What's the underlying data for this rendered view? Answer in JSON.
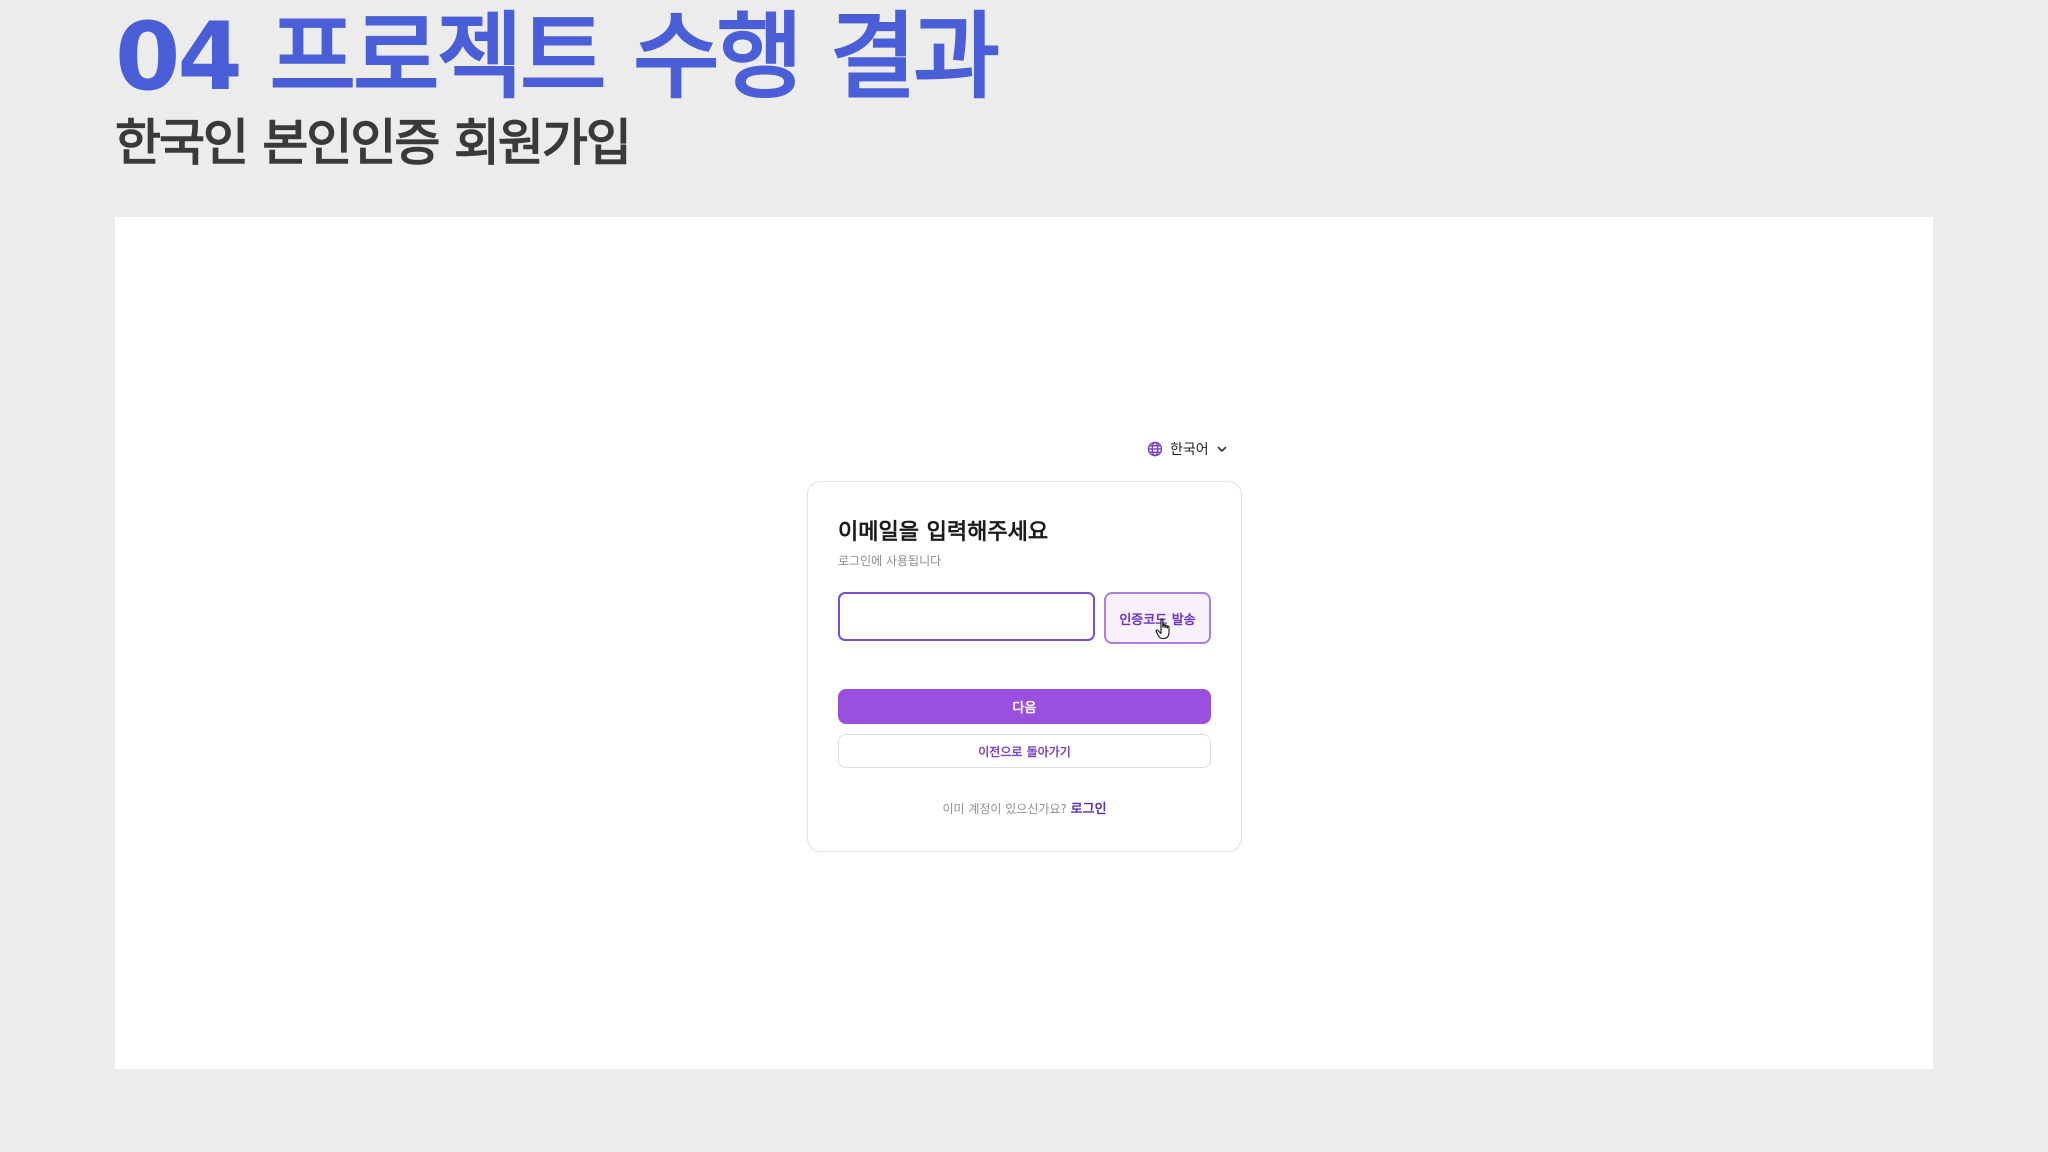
{
  "slide": {
    "title": "04 프로젝트 수행 결과",
    "subtitle": "한국인 본인인증 회원가입"
  },
  "language_selector": {
    "icon": "globe-icon",
    "label": "한국어",
    "caret_icon": "chevron-down-icon"
  },
  "signup_card": {
    "title": "이메일을 입력해주세요",
    "description": "로그인에 사용됩니다",
    "email_input": {
      "value": "",
      "placeholder": ""
    },
    "send_code_label": "인증코드 발송",
    "next_label": "다음",
    "back_label": "이전으로 돌아가기",
    "login_prompt": "이미 계정이 있으신가요?",
    "login_link": "로그인"
  },
  "colors": {
    "title_blue": "#4a5ed8",
    "primary_purple": "#9a4fde",
    "accent_purple": "#6f35c2",
    "slide_background": "#ececed"
  }
}
